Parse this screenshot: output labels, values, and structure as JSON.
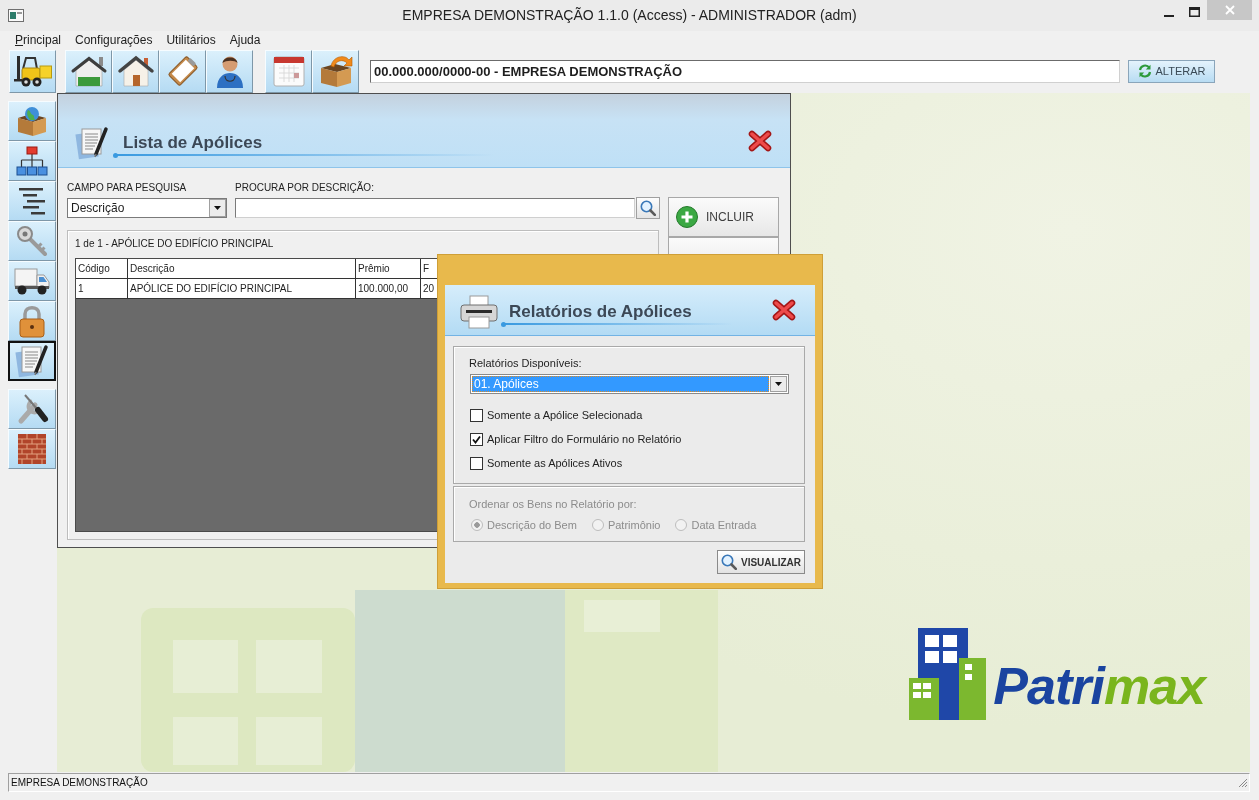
{
  "window": {
    "title": "EMPRESA DEMONSTRAÇÃO 1.1.0 (Access) - ADMINISTRADOR (adm)"
  },
  "menu": [
    {
      "label": "Principal",
      "mnemonic": true
    },
    {
      "label": "Configurações",
      "mnemonic": false
    },
    {
      "label": "Utilitários",
      "mnemonic": false
    },
    {
      "label": "Ajuda",
      "mnemonic": false
    }
  ],
  "company_field": {
    "value": "00.000.000/0000-00 - EMPRESA DEMONSTRAÇÃO"
  },
  "change_button": {
    "label": "ALTERAR"
  },
  "sidebar": {
    "items": [
      {
        "selected": false
      },
      {
        "selected": false
      },
      {
        "selected": false
      },
      {
        "selected": false
      },
      {
        "selected": false
      },
      {
        "selected": false
      },
      {
        "selected": true
      },
      {
        "selected": false
      },
      {
        "selected": false
      }
    ]
  },
  "list_window": {
    "title": "Lista de Apólices",
    "search_field_label": "CAMPO PARA PESQUISA",
    "search_field": {
      "value": "Descrição"
    },
    "search_label": "PROCURA POR DESCRIÇÃO:",
    "buttons": [
      {
        "label": "INCLUIR"
      }
    ],
    "summary": "1 de 1 - APÓLICE DO EDIFÍCIO PRINCIPAL",
    "table": {
      "columns": [
        "Código",
        "Descrição",
        "Prêmio",
        "F"
      ],
      "rows": [
        [
          "1",
          "APÓLICE DO EDIFÍCIO PRINCIPAL",
          "100.000,00",
          "20"
        ]
      ]
    }
  },
  "report_dialog": {
    "title": "Relatórios de Apólices",
    "reports_label": "Relatórios Disponíveis:",
    "report_select": {
      "value": "01. Apólices",
      "focused": true
    },
    "options": [
      {
        "label": "Somente a Apólice Selecionada",
        "checked": false
      },
      {
        "label": "Aplicar Filtro do Formulário no Relatório",
        "checked": true
      },
      {
        "label": "Somente as Apólices Ativos",
        "checked": false
      }
    ],
    "sort": {
      "label": "Ordenar os Bens no Relatório por:",
      "disabled": true,
      "choices": [
        {
          "label": "Descrição do Bem",
          "selected": true
        },
        {
          "label": "Patrimônio",
          "selected": false
        },
        {
          "label": "Data Entrada",
          "selected": false
        }
      ]
    },
    "view_button": "VISUALIZAR"
  },
  "logo": {
    "parts": [
      "Patri",
      "max"
    ]
  },
  "status_bar": {
    "text": "EMPRESA DEMONSTRAÇÃO"
  }
}
